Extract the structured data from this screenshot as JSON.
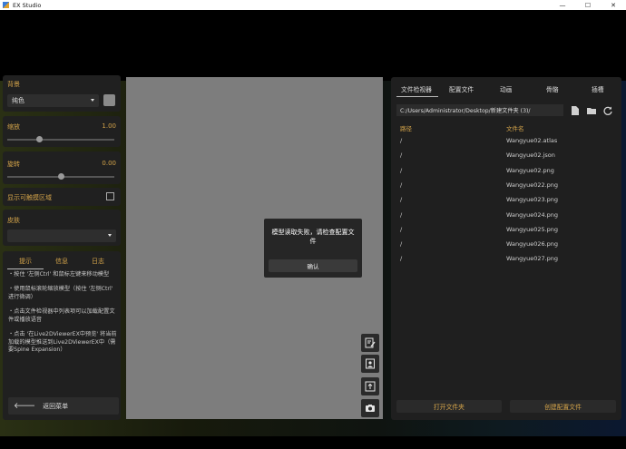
{
  "window": {
    "title": "EX Studio",
    "controls": [
      "—",
      "☐",
      "✕"
    ]
  },
  "left_panel": {
    "background": {
      "label": "背景",
      "dropdown_value": "纯色"
    },
    "scale": {
      "label": "缩放",
      "value": "1.00",
      "fraction": 0.3
    },
    "rotate": {
      "label": "旋转",
      "value": "0.00",
      "fraction": 0.5
    },
    "show_touch_area": {
      "label": "显示可触摸区域"
    },
    "skin": {
      "label": "皮肤",
      "dropdown_value": ""
    },
    "tabs": [
      "提示",
      "信息",
      "日志"
    ],
    "hints": [
      "・按住 '左侧Ctrl' 和鼠标左键来移动模型",
      "・使用鼠标滚轮缩放模型（按住 '左侧Ctrl' 进行微调）",
      "・点击文件检视器中列表项可以加载配置文件或播放语音",
      "・点击 '在Live2DViewerEX中预览' 将当前加载的模型推送到Live2DViewerEX中（需要Spine Expansion）"
    ],
    "back_button": "返回菜单"
  },
  "dialog": {
    "message": "模型读取失败，请检查配置文件",
    "confirm": "确认"
  },
  "right_panel": {
    "tabs": [
      "文件检视器",
      "配置文件",
      "动画",
      "骨骼",
      "插槽"
    ],
    "path": "C:/Users/Administrator/Desktop/新建文件夹 (3)/",
    "columns": [
      "路径",
      "文件名"
    ],
    "rows": [
      {
        "path": "/",
        "file": "Wangyue02.atlas"
      },
      {
        "path": "/",
        "file": "Wangyue02.json"
      },
      {
        "path": "/",
        "file": "Wangyue02.png"
      },
      {
        "path": "/",
        "file": "Wangyue022.png"
      },
      {
        "path": "/",
        "file": "Wangyue023.png"
      },
      {
        "path": "/",
        "file": "Wangyue024.png"
      },
      {
        "path": "/",
        "file": "Wangyue025.png"
      },
      {
        "path": "/",
        "file": "Wangyue026.png"
      },
      {
        "path": "/",
        "file": "Wangyue027.png"
      }
    ],
    "open_folder": "打开文件夹",
    "create_config": "创建配置文件"
  }
}
